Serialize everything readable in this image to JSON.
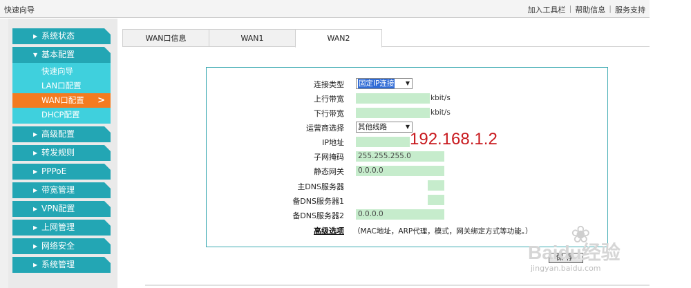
{
  "header": {
    "title": "快速向导",
    "links": [
      "加入工具栏",
      "帮助信息",
      "服务支持"
    ]
  },
  "sidebar": {
    "items": [
      {
        "label": "系统状态"
      },
      {
        "label": "基本配置",
        "open": true
      },
      {
        "label": "高级配置"
      },
      {
        "label": "转发规则"
      },
      {
        "label": "PPPoE"
      },
      {
        "label": "带宽管理"
      },
      {
        "label": "VPN配置"
      },
      {
        "label": "上网管理"
      },
      {
        "label": "网络安全"
      },
      {
        "label": "系统管理"
      }
    ],
    "subitems": [
      {
        "label": "快速向导"
      },
      {
        "label": "LAN口配置"
      },
      {
        "label": "WAN口配置",
        "active": true
      },
      {
        "label": "DHCP配置"
      }
    ]
  },
  "tabs": [
    {
      "label": "WAN口信息"
    },
    {
      "label": "WAN1"
    },
    {
      "label": "WAN2",
      "active": true
    }
  ],
  "form": {
    "conn_type_label": "连接类型",
    "conn_type_value": "固定IP连接",
    "up_bw_label": "上行带宽",
    "up_bw_value": "",
    "up_bw_unit": "kbit/s",
    "down_bw_label": "下行带宽",
    "down_bw_value": "",
    "down_bw_unit": "kbit/s",
    "isp_label": "运营商选择",
    "isp_value": "其他线路",
    "ip_label": "IP地址",
    "ip_value": "192.168.1.2",
    "mask_label": "子网掩码",
    "mask_value": "255.255.255.0",
    "gw_label": "静态网关",
    "gw_value": "0.0.0.0",
    "dns1_label": "主DNS服务器",
    "dns1_value": "",
    "dns2_label": "备DNS服务器1",
    "dns2_value": "",
    "dns3_label": "备DNS服务器2",
    "dns3_value": "0.0.0.0",
    "advanced_label": "高级选项",
    "advanced_note": "（MAC地址，ARP代理，模式，网关绑定方式等功能。）",
    "save_label": "保存"
  },
  "watermark": {
    "brand": "Baidu经验",
    "site": "jingyan.baidu.com"
  },
  "colors": {
    "menu": "#23a6b4",
    "submenu": "#3fd0dd",
    "active": "#f47b20",
    "field": "#c6eccc",
    "panel_border": "#3aa9b1",
    "ip_overlay": "#c8191e"
  }
}
